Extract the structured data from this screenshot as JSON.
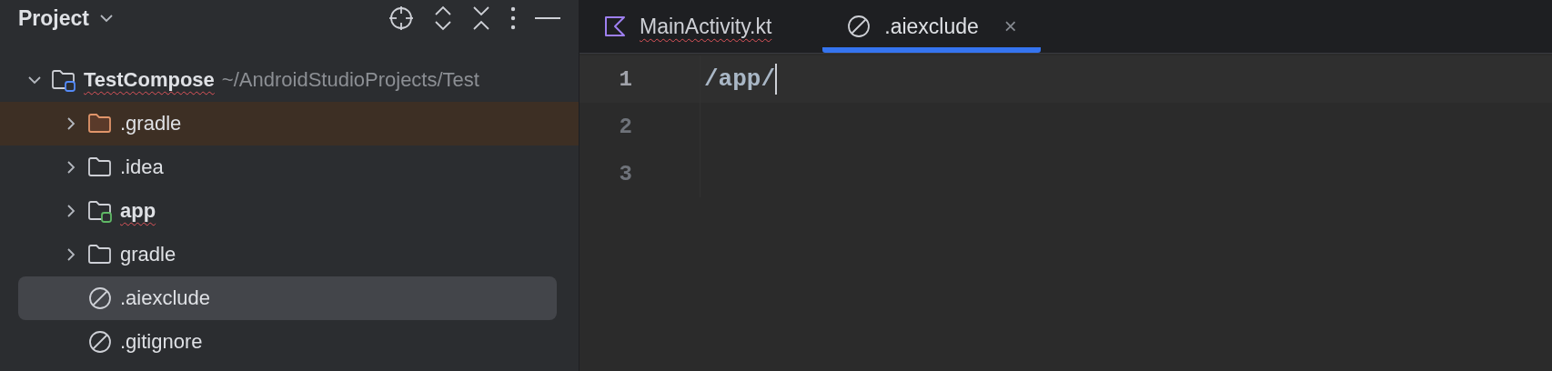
{
  "project_panel": {
    "title": "Project",
    "tree": [
      {
        "kind": "module",
        "label": "TestCompose",
        "path": "~/AndroidStudioProjects/Test",
        "expanded": true,
        "selected": false,
        "ignored": false,
        "misspelled": true,
        "color": "#548af7",
        "children": [
          {
            "kind": "folder",
            "label": ".gradle",
            "expanded": false,
            "selected": false,
            "ignored": true,
            "misspelled": false
          },
          {
            "kind": "folder",
            "label": ".idea",
            "expanded": false,
            "selected": false,
            "ignored": false,
            "misspelled": false
          },
          {
            "kind": "module",
            "label": "app",
            "expanded": false,
            "selected": false,
            "ignored": false,
            "misspelled": true,
            "color": "#5fb865"
          },
          {
            "kind": "folder",
            "label": "gradle",
            "expanded": false,
            "selected": false,
            "ignored": false,
            "misspelled": false
          },
          {
            "kind": "file",
            "label": ".aiexclude",
            "selected": true,
            "ignored": false,
            "misspelled": false
          },
          {
            "kind": "file",
            "label": ".gitignore",
            "selected": false,
            "ignored": false,
            "misspelled": false
          }
        ]
      }
    ]
  },
  "editor": {
    "tabs": [
      {
        "kind": "kotlin",
        "label": "MainActivity.kt",
        "selected": false,
        "misspelled": true
      },
      {
        "kind": "file",
        "label": ".aiexclude",
        "selected": true,
        "misspelled": false,
        "close": "×"
      }
    ],
    "lines": [
      {
        "number": "1",
        "text": "/app/",
        "current": true,
        "caret": true
      },
      {
        "number": "2",
        "current": false,
        "caret": false
      },
      {
        "number": "3",
        "current": false,
        "caret": false
      }
    ]
  }
}
